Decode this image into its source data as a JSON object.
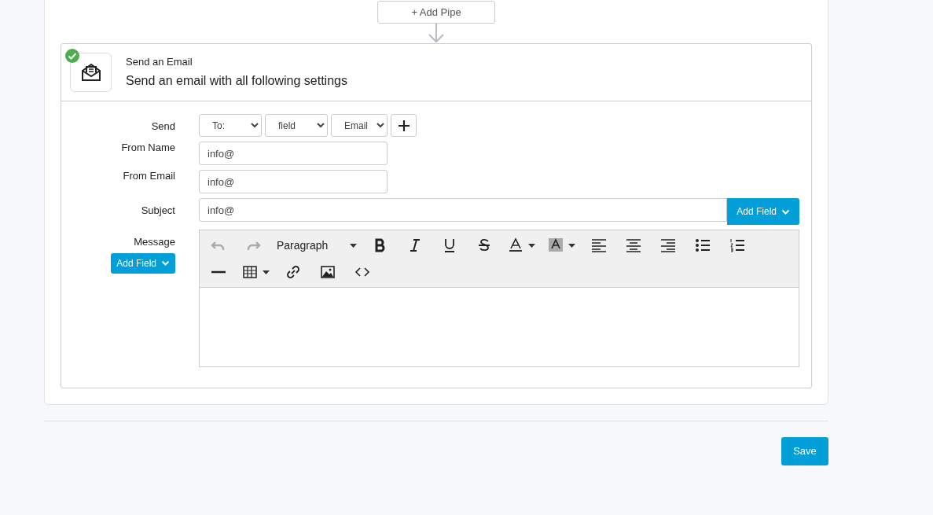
{
  "add_pipe_button": {
    "label": "+ Add Pipe"
  },
  "step": {
    "checked": true,
    "title": "Send an Email",
    "description": "Send an email with all following settings",
    "fields": [
      {
        "kind": "selects",
        "label": "Send",
        "selects": [
          "To:",
          "field",
          "Email"
        ]
      },
      {
        "kind": "input",
        "label": "From Name",
        "value": "info@"
      },
      {
        "kind": "input",
        "label": "From Email",
        "value": "info@"
      },
      {
        "kind": "input_addon",
        "label": "Subject",
        "value": "info@",
        "button": "Add Field"
      },
      {
        "kind": "editor",
        "label": "Message",
        "button": "Add Field",
        "block_format": "Paragraph",
        "toolbar": [
          {
            "kind": "undo",
            "disabled": true
          },
          {
            "kind": "redo",
            "disabled": true
          },
          {
            "kind": "format",
            "disabled": false
          },
          {
            "kind": "bold",
            "disabled": false
          },
          {
            "kind": "italic",
            "disabled": false
          },
          {
            "kind": "underline",
            "disabled": false
          },
          {
            "kind": "strike",
            "disabled": false
          },
          {
            "kind": "textcolor",
            "disabled": false
          },
          {
            "kind": "bgcolor",
            "disabled": false
          },
          {
            "kind": "alignleft",
            "disabled": false
          },
          {
            "kind": "aligncenter",
            "disabled": false
          },
          {
            "kind": "alignright",
            "disabled": false
          },
          {
            "kind": "bullist",
            "disabled": false
          },
          {
            "kind": "numlist",
            "disabled": false
          },
          {
            "kind": "break"
          },
          {
            "kind": "hr",
            "disabled": false
          },
          {
            "kind": "table",
            "disabled": false
          },
          {
            "kind": "link",
            "disabled": false
          },
          {
            "kind": "image",
            "disabled": false
          },
          {
            "kind": "code",
            "disabled": false
          }
        ]
      }
    ]
  },
  "save_button": {
    "label": "Save"
  }
}
